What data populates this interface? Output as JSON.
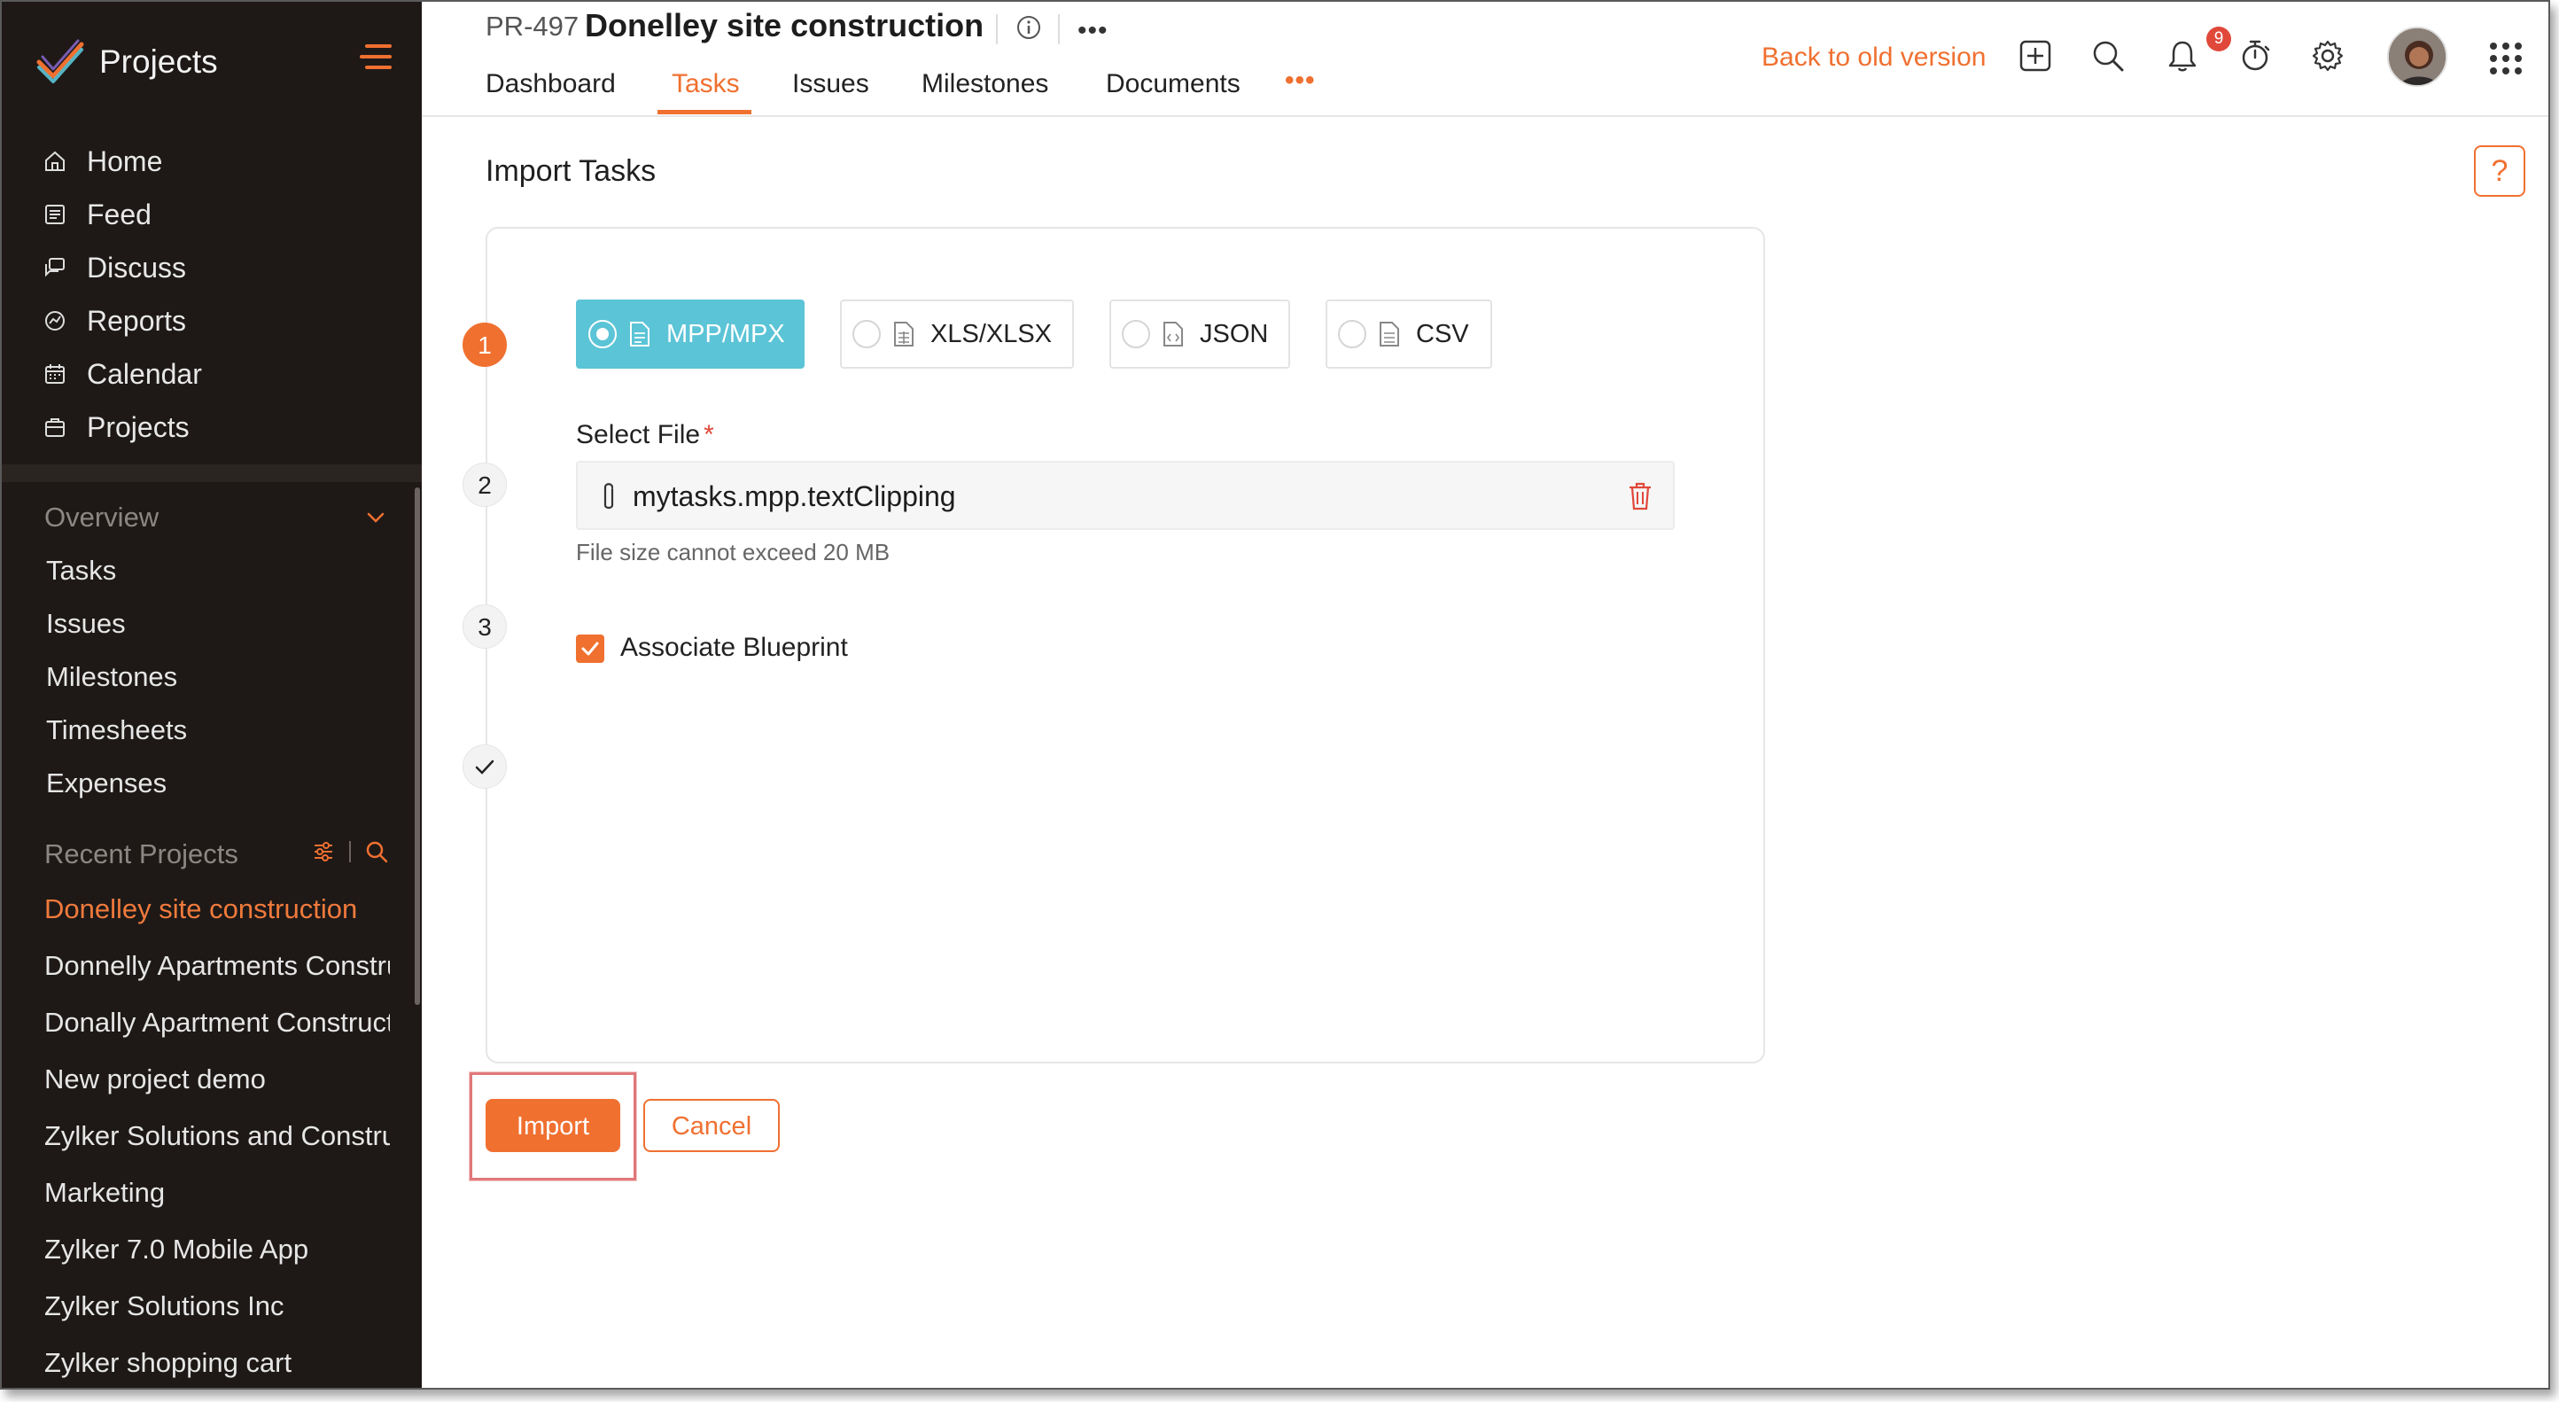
{
  "sidebar": {
    "app_title": "Projects",
    "main_items": [
      {
        "label": "Home",
        "icon": "home-icon"
      },
      {
        "label": "Feed",
        "icon": "feed-icon"
      },
      {
        "label": "Discuss",
        "icon": "discuss-icon"
      },
      {
        "label": "Reports",
        "icon": "reports-icon"
      },
      {
        "label": "Calendar",
        "icon": "calendar-icon"
      },
      {
        "label": "Projects",
        "icon": "projects-icon"
      }
    ],
    "overview_label": "Overview",
    "overview_items": [
      "Tasks",
      "Issues",
      "Milestones",
      "Timesheets",
      "Expenses"
    ],
    "recent_label": "Recent Projects",
    "recent_projects": [
      "Donelley site construction",
      "Donnelly Apartments Construction",
      "Donally Apartment Construction",
      "New project demo",
      "Zylker Solutions and Construction",
      "Marketing",
      "Zylker 7.0 Mobile App",
      "Zylker Solutions Inc",
      "Zylker shopping cart"
    ]
  },
  "header": {
    "project_id": "PR-497",
    "project_name": "Donelley site construction",
    "tabs": [
      "Dashboard",
      "Tasks",
      "Issues",
      "Milestones",
      "Documents"
    ],
    "active_tab": "Tasks",
    "more_label": "•••",
    "back_old_version": "Back to old version",
    "notification_count": "9"
  },
  "main": {
    "page_title": "Import Tasks",
    "help_label": "?",
    "steps": [
      "1",
      "2",
      "3"
    ],
    "formats": [
      "MPP/MPX",
      "XLS/XLSX",
      "JSON",
      "CSV"
    ],
    "selected_format": "MPP/MPX",
    "select_file_label": "Select File",
    "required_mark": "*",
    "file_name": "mytasks.mpp.textClipping",
    "file_hint": "File size cannot exceed 20 MB",
    "associate_blueprint_label": "Associate Blueprint",
    "associate_blueprint_checked": true,
    "import_button": "Import",
    "cancel_button": "Cancel"
  },
  "colors": {
    "accent": "#f07030",
    "sidebar_bg": "#1e1917",
    "selected_format_bg": "#5bc4d6"
  }
}
